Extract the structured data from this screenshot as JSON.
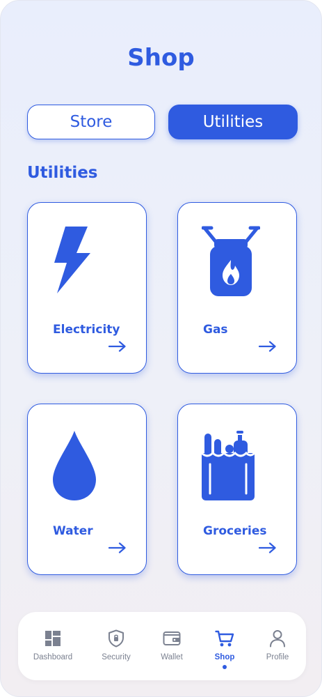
{
  "header": {
    "title": "Shop"
  },
  "segments": {
    "store": "Store",
    "utilities": "Utilities",
    "active": "utilities"
  },
  "section_title": "Utilities",
  "cards": [
    {
      "label": "Electricity",
      "icon": "lightning-icon"
    },
    {
      "label": "Gas",
      "icon": "gas-cylinder-icon"
    },
    {
      "label": "Water",
      "icon": "water-drop-icon"
    },
    {
      "label": "Groceries",
      "icon": "grocery-bag-icon"
    }
  ],
  "nav": {
    "items": [
      {
        "label": "Dashboard",
        "icon": "dashboard-icon"
      },
      {
        "label": "Security",
        "icon": "shield-lock-icon"
      },
      {
        "label": "Wallet",
        "icon": "wallet-icon"
      },
      {
        "label": "Shop",
        "icon": "cart-icon"
      },
      {
        "label": "Profile",
        "icon": "user-icon"
      }
    ],
    "active": "Shop"
  },
  "colors": {
    "accent": "#2f5be0",
    "inactive": "#7b8190"
  }
}
